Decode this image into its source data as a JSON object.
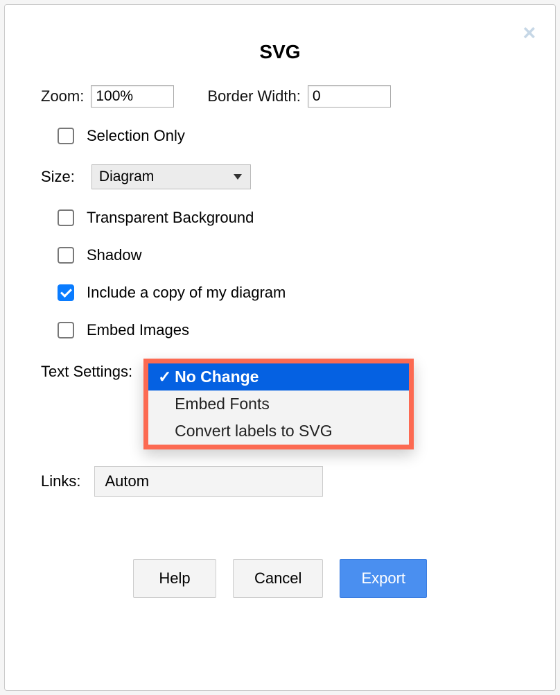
{
  "dialog": {
    "title": "SVG",
    "zoom_label": "Zoom:",
    "zoom_value": "100%",
    "border_label": "Border Width:",
    "border_value": "0",
    "selection_only_label": "Selection Only",
    "selection_only_checked": false,
    "size_label": "Size:",
    "size_value": "Diagram",
    "transparent_label": "Transparent Background",
    "transparent_checked": false,
    "shadow_label": "Shadow",
    "shadow_checked": false,
    "include_copy_label": "Include a copy of my diagram",
    "include_copy_checked": true,
    "embed_images_label": "Embed Images",
    "embed_images_checked": false,
    "text_settings_label": "Text Settings:",
    "text_settings_options": [
      {
        "label": "No Change",
        "selected": true
      },
      {
        "label": "Embed Fonts",
        "selected": false
      },
      {
        "label": "Convert labels to SVG",
        "selected": false
      }
    ],
    "links_label": "Links:",
    "links_value": "Autom",
    "buttons": {
      "help": "Help",
      "cancel": "Cancel",
      "export": "Export"
    }
  }
}
